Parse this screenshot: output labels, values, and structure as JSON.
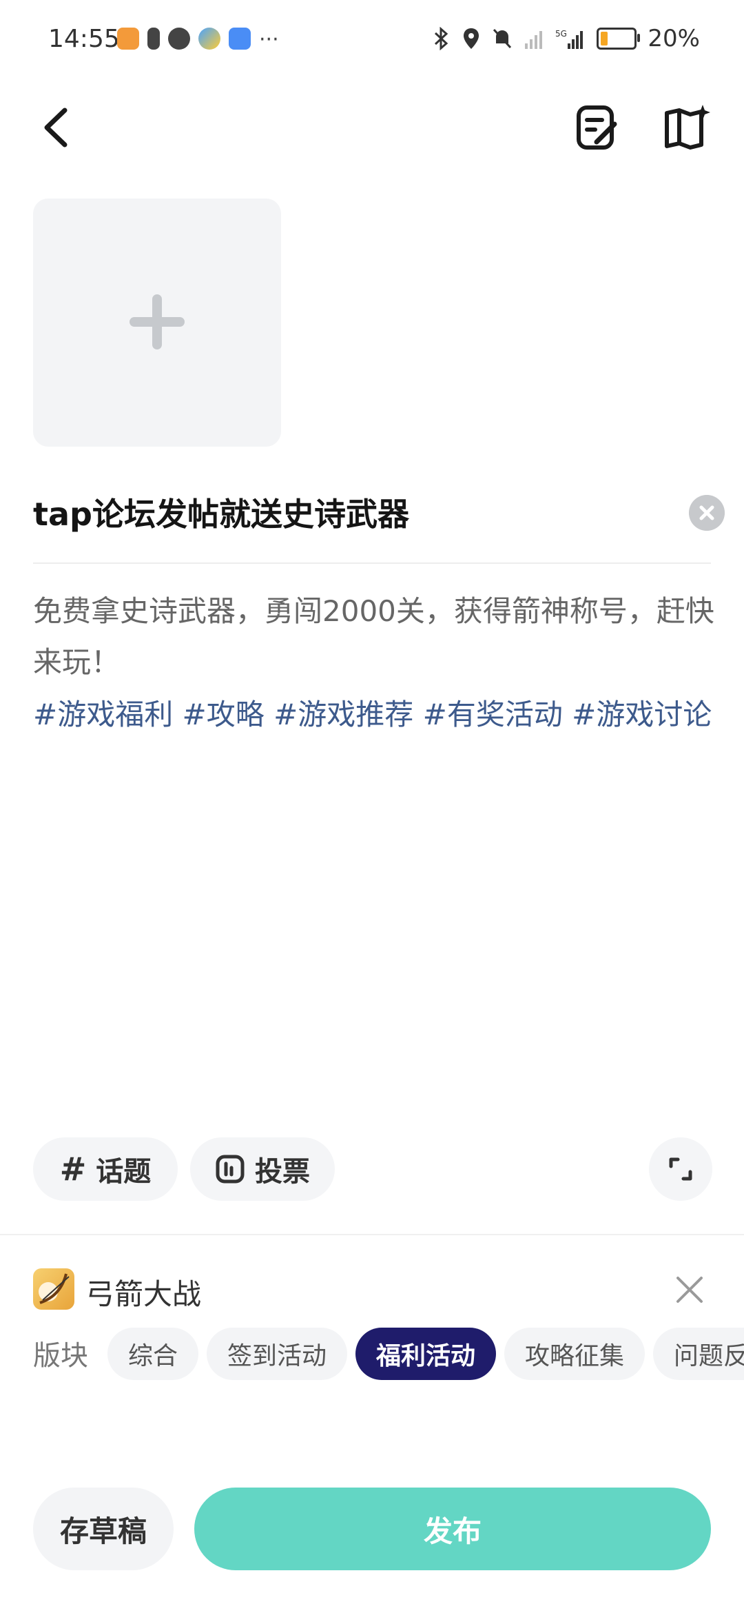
{
  "status_bar": {
    "time": "14:55",
    "battery_percent": "20%",
    "more_indicator": "···"
  },
  "header": {
    "back_icon": "chevron-left-icon",
    "draft_edit_icon": "edit-document-icon",
    "guide_icon": "book-sparkle-icon"
  },
  "post": {
    "title": "tap论坛发帖就送史诗武器",
    "body": "免费拿史诗武器，勇闯2000关，获得箭神称号，赶快来玩！",
    "tags_text": "#游戏福利 #攻略 #游戏推荐 #有奖活动 #游戏讨论"
  },
  "tools": {
    "topic_label": "话题",
    "vote_label": "投票"
  },
  "game": {
    "name": "弓箭大战"
  },
  "sections": {
    "label": "版块",
    "items": [
      "综合",
      "签到活动",
      "福利活动",
      "攻略征集",
      "问题反"
    ],
    "selected": "福利活动"
  },
  "actions": {
    "draft_label": "存草稿",
    "publish_label": "发布"
  },
  "colors": {
    "accent_selected": "#1f1c6b",
    "publish_button": "#63d6c4",
    "tag_color": "#3d5a8c"
  }
}
